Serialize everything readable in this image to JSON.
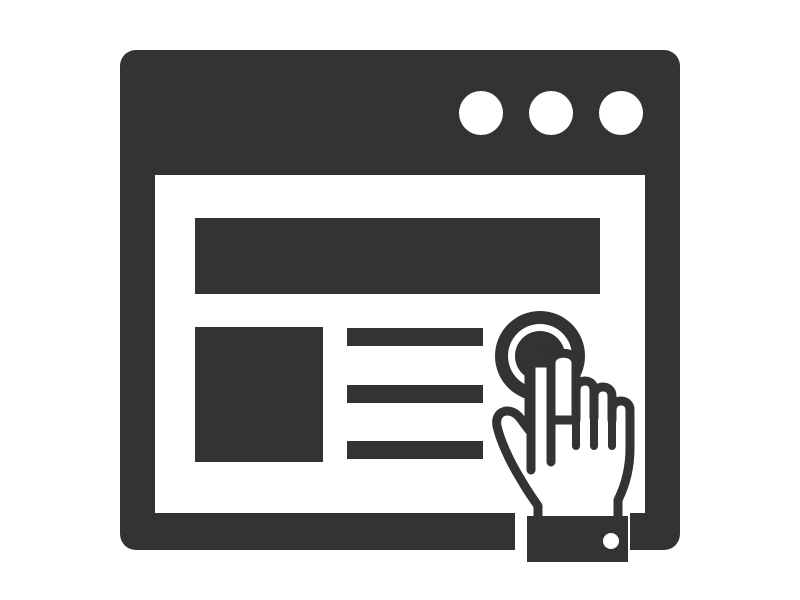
{
  "icon": {
    "name": "web-page-touch-icon",
    "colors": {
      "ink": "#333333",
      "paper": "#ffffff"
    },
    "parts": [
      "browser-window-icon",
      "window-control-dot-icon",
      "page-header-bar-icon",
      "image-placeholder-icon",
      "text-line-icon",
      "tap-ripple-icon",
      "pointing-hand-icon",
      "sleeve-cuff-icon",
      "cuff-button-icon"
    ]
  }
}
